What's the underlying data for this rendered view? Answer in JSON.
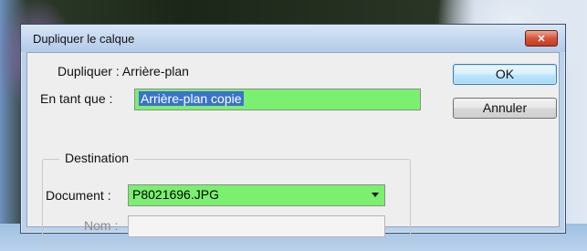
{
  "dialog": {
    "title": "Dupliquer le calque",
    "close_glyph": "✕",
    "duplicate_label": "Dupliquer : ",
    "duplicate_value": "Arrière-plan",
    "as_label": "En tant que :",
    "as_value": "Arrière-plan copie",
    "destination": {
      "legend": "Destination",
      "document_label": "Document :",
      "document_value": "P8021696.JPG",
      "name_label": "Nom :",
      "name_value": ""
    },
    "buttons": {
      "ok": "OK",
      "cancel": "Annuler"
    }
  },
  "colors": {
    "highlight_field": "#7af06e",
    "selection": "#3a73c9",
    "default_button_border": "#3c7fb1"
  },
  "icons": {
    "close": "close-icon",
    "dropdown": "chevron-down-icon"
  }
}
